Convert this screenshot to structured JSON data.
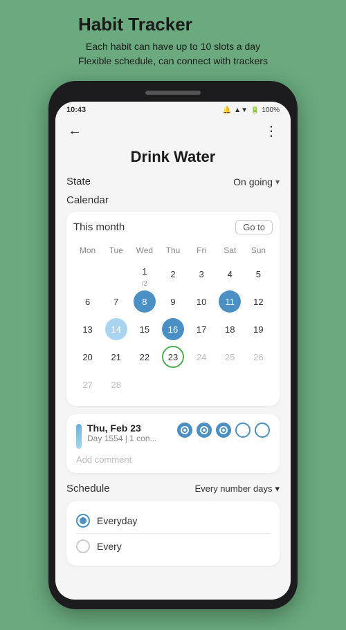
{
  "header": {
    "title": "Habit Tracker",
    "subtitle_line1": "Each habit can have up to 10 slots a day",
    "subtitle_line2": "Flexible schedule, can connect with trackers"
  },
  "status_bar": {
    "time": "10:43",
    "battery": "100%",
    "signal": "▲▼"
  },
  "screen": {
    "back_icon": "←",
    "more_icon": "⋮",
    "habit_name": "Drink Water",
    "state_label": "State",
    "state_value": "On going",
    "calendar_label": "Calendar",
    "this_month": "This month",
    "goto_label": "Go to",
    "days_of_week": [
      "Mon",
      "Tue",
      "Wed",
      "Thu",
      "Fri",
      "Sat",
      "Sun"
    ],
    "week1": [
      "",
      "",
      "1/2",
      "2",
      "3",
      "4",
      "5"
    ],
    "week2": [
      "6",
      "7",
      "8",
      "9",
      "10",
      "11",
      "12"
    ],
    "week3": [
      "13",
      "14",
      "15",
      "16",
      "17",
      "18",
      "19"
    ],
    "week4": [
      "20",
      "21",
      "22",
      "23",
      "24",
      "25",
      "26"
    ],
    "week5": [
      "27",
      "28",
      "",
      "",
      "",
      "",
      ""
    ],
    "detail_date": "Thu, Feb 23",
    "detail_sub": "Day 1554 | 1 con...",
    "add_comment": "Add comment",
    "schedule_label": "Schedule",
    "schedule_value": "Every number days",
    "schedule_option1": "Everyday",
    "schedule_option2": "Every"
  }
}
